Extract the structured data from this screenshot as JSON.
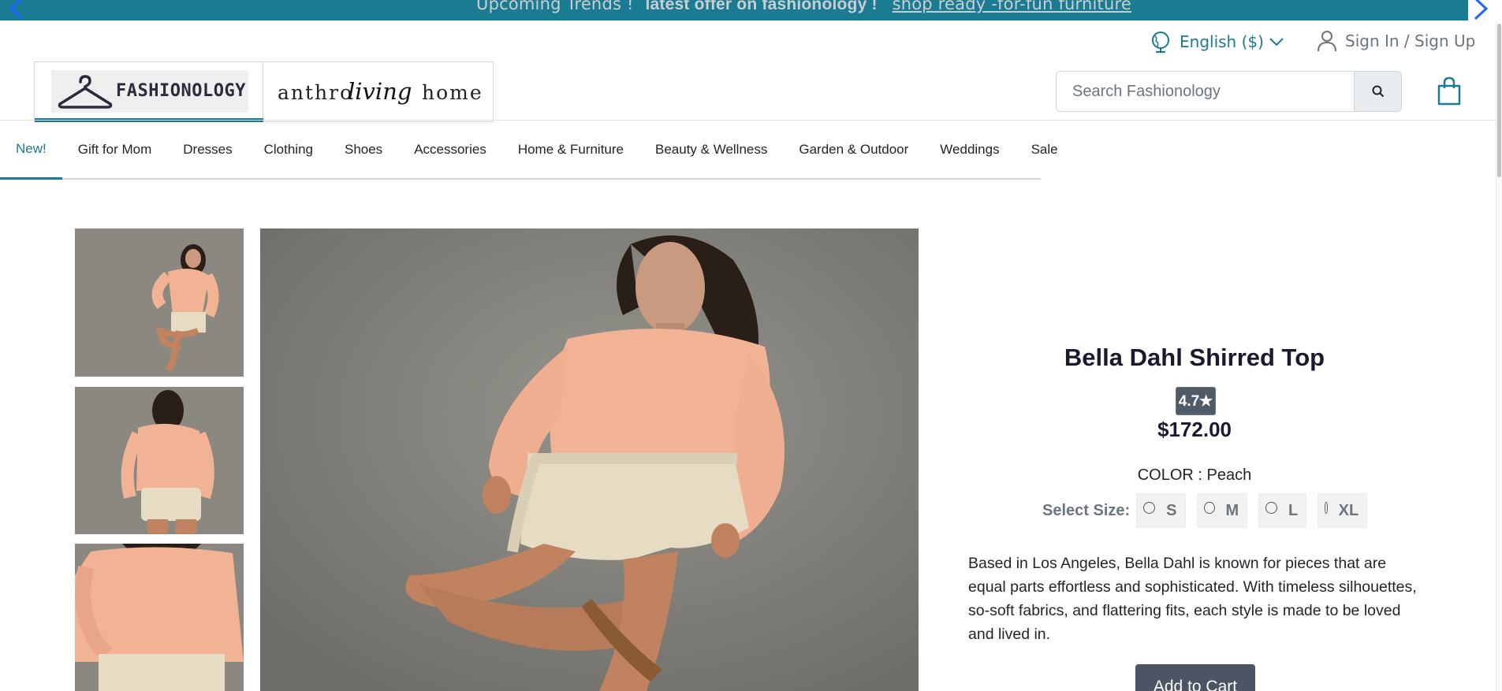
{
  "promo": {
    "upcoming": "Upcoming Trends !",
    "offer": "latest offer on fashionology !",
    "link": "shop ready -for-fun furniture"
  },
  "header": {
    "language": "English ($)",
    "sign_in": "Sign In / Sign Up",
    "search_placeholder": "Search Fashionology"
  },
  "brands": [
    {
      "name": "FASHIONOLOGY",
      "active": true
    },
    {
      "name": "anthroliving home",
      "active": false
    }
  ],
  "nav": {
    "items": [
      "New!",
      "Gift for Mom",
      "Dresses",
      "Clothing",
      "Shoes",
      "Accessories",
      "Home & Furniture",
      "Beauty & Wellness",
      "Garden & Outdoor",
      "Weddings",
      "Sale"
    ],
    "active_index": 0
  },
  "product": {
    "title": "Bella Dahl Shirred Top",
    "rating": "4.7★",
    "price": "$172.00",
    "color_line": "COLOR : Peach",
    "size_label": "Select Size:",
    "sizes": [
      "S",
      "M",
      "L",
      "XL"
    ],
    "description": "Based in Los Angeles, Bella Dahl is known for pieces that are equal parts effortless and sophisticated. With timeless silhouettes, so-soft fabrics, and flattering fits, each style is made to be loved and lived in.",
    "add_to_cart": "Add to Cart"
  },
  "colors": {
    "accent": "#1a7b92",
    "button": "#4b5563",
    "rating_bg": "#4f5b66"
  },
  "icons": [
    "chevron-left-icon",
    "chevron-right-icon",
    "globe-icon",
    "chevron-down-icon",
    "user-icon",
    "hanger-icon",
    "search-icon",
    "shopping-bag-icon"
  ]
}
